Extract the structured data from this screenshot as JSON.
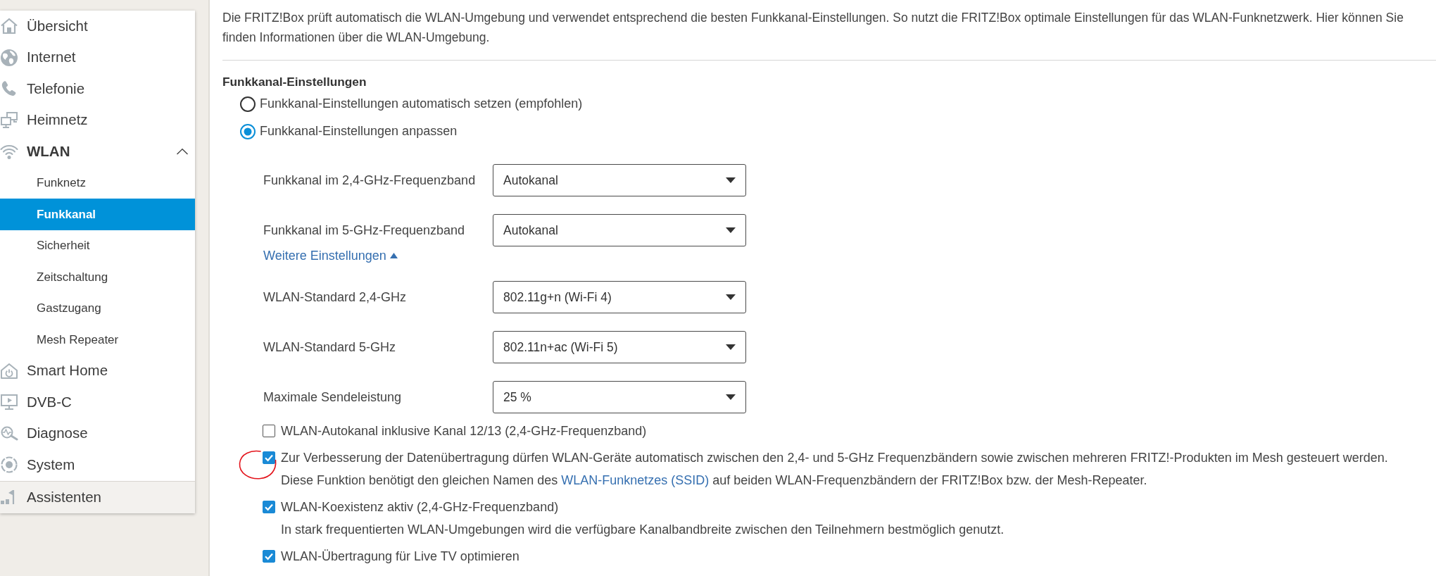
{
  "sidebar": {
    "items": [
      {
        "label": "Übersicht",
        "selected": false,
        "expanded": false
      },
      {
        "label": "Internet",
        "selected": false,
        "expanded": false
      },
      {
        "label": "Telefonie",
        "selected": false,
        "expanded": false
      },
      {
        "label": "Heimnetz",
        "selected": false,
        "expanded": false
      },
      {
        "label": "WLAN",
        "selected": false,
        "expanded": true,
        "children": [
          {
            "label": "Funknetz",
            "selected": false
          },
          {
            "label": "Funkkanal",
            "selected": true
          },
          {
            "label": "Sicherheit",
            "selected": false
          },
          {
            "label": "Zeitschaltung",
            "selected": false
          },
          {
            "label": "Gastzugang",
            "selected": false
          },
          {
            "label": "Mesh Repeater",
            "selected": false
          }
        ]
      },
      {
        "label": "Smart Home",
        "selected": false,
        "expanded": false
      },
      {
        "label": "DVB-C",
        "selected": false,
        "expanded": false
      },
      {
        "label": "Diagnose",
        "selected": false,
        "expanded": false
      },
      {
        "label": "System",
        "selected": false,
        "expanded": false
      }
    ],
    "footer": {
      "label": "Assistenten",
      "selected": false
    }
  },
  "intro": {
    "lines": [
      "Die FRITZ!Box prüft automatisch die WLAN-Umgebung und verwendet entsprechend die besten Funkkanal-Einstellungen. So nutzt die FRITZ!Box optimale Einstellungen für das WLAN-Funknetzwerk. Hier können Sie",
      "finden Informationen über die WLAN-Umgebung."
    ]
  },
  "channel_settings": {
    "title": "Funkkanal-Einstellungen",
    "options": [
      {
        "label": "Funkkanal-Einstellungen automatisch setzen (empfohlen)",
        "selected": false
      },
      {
        "label": "Funkkanal-Einstellungen anpassen",
        "selected": true
      }
    ],
    "channel_selects": [
      {
        "label": "Funkkanal im 2,4-GHz-Frequenzband",
        "value": "Autokanal"
      },
      {
        "label": "Funkkanal im 5-GHz-Frequenzband",
        "value": "Autokanal"
      }
    ],
    "more_link": {
      "label": "Weitere Einstellungen",
      "expanded": true
    },
    "advanced_selects": [
      {
        "label": "WLAN-Standard 2,4-GHz",
        "value": "802.11g+n (Wi-Fi 4)"
      },
      {
        "label": "WLAN-Standard 5-GHz",
        "value": "802.11n+ac (Wi-Fi 5)"
      },
      {
        "label": "Maximale Sendeleistung",
        "value": "25 %"
      }
    ],
    "checkboxes": [
      {
        "label": "WLAN-Autokanal inklusive Kanal 12/13 (2,4-GHz-Frequenzband)",
        "checked": false,
        "highlighted": false
      },
      {
        "label": "Zur Verbesserung der Datenübertragung dürfen WLAN-Geräte automatisch zwischen den 2,4- und 5-GHz Frequenzbändern sowie zwischen mehreren FRITZ!-Produkten im Mesh gesteuert werden.",
        "checked": true,
        "highlighted": true,
        "description": [
          {
            "kind": "text",
            "text": "Diese Funktion benötigt den gleichen Namen des "
          },
          {
            "kind": "link",
            "text": "WLAN-Funknetzes (SSID)"
          },
          {
            "kind": "text",
            "text": " auf beiden WLAN-Frequenzbändern der FRITZ!Box bzw. der Mesh-Repeater."
          }
        ]
      },
      {
        "label": "WLAN-Koexistenz aktiv (2,4-GHz-Frequenzband)",
        "checked": true,
        "highlighted": false,
        "description": [
          {
            "kind": "text",
            "text": "In stark frequentierten WLAN-Umgebungen wird die verfügbare Kanalbandbreite zwischen den Teilnehmern bestmöglich genutzt."
          }
        ]
      },
      {
        "label": "WLAN-Übertragung für Live TV optimieren",
        "checked": true,
        "highlighted": false
      }
    ]
  }
}
